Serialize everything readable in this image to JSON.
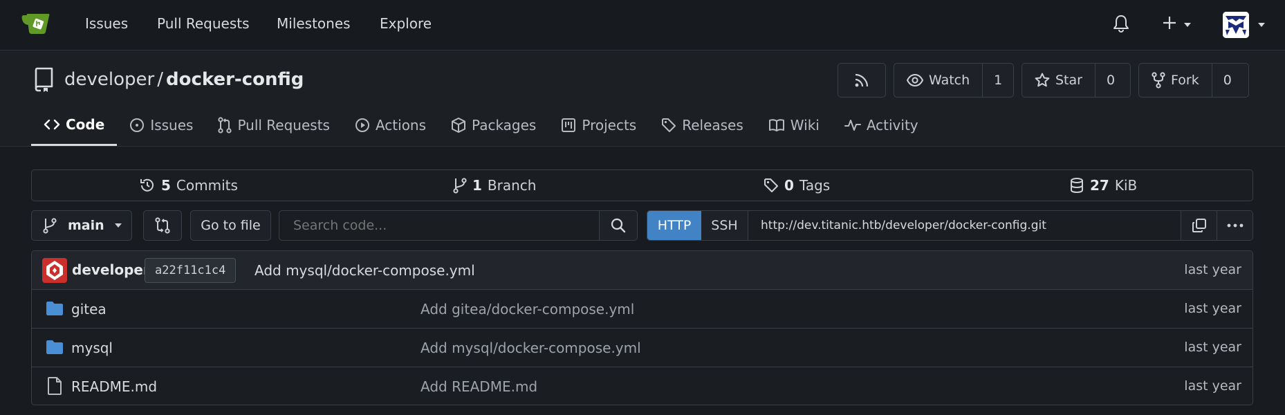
{
  "nav": {
    "links": [
      "Issues",
      "Pull Requests",
      "Milestones",
      "Explore"
    ]
  },
  "repo": {
    "owner": "developer",
    "separator": "/",
    "name": "docker-config",
    "watch_label": "Watch",
    "watch_count": "1",
    "star_label": "Star",
    "star_count": "0",
    "fork_label": "Fork",
    "fork_count": "0"
  },
  "tabs": [
    {
      "label": "Code",
      "icon": "code-icon"
    },
    {
      "label": "Issues",
      "icon": "issue-icon"
    },
    {
      "label": "Pull Requests",
      "icon": "pull-request-icon"
    },
    {
      "label": "Actions",
      "icon": "play-icon"
    },
    {
      "label": "Packages",
      "icon": "package-icon"
    },
    {
      "label": "Projects",
      "icon": "project-icon"
    },
    {
      "label": "Releases",
      "icon": "tag-icon"
    },
    {
      "label": "Wiki",
      "icon": "book-icon"
    },
    {
      "label": "Activity",
      "icon": "pulse-icon"
    }
  ],
  "stats": {
    "commits_count": "5",
    "commits_label": "Commits",
    "branch_count": "1",
    "branch_label": "Branch",
    "tags_count": "0",
    "tags_label": "Tags",
    "size_count": "27",
    "size_label": "KiB"
  },
  "toolbar": {
    "branch": "main",
    "go_to_file": "Go to file",
    "search_placeholder": "Search code...",
    "http_label": "HTTP",
    "ssh_label": "SSH",
    "clone_url": "http://dev.titanic.htb/developer/docker-config.git"
  },
  "last_commit": {
    "author": "developer",
    "sha": "a22f11c1c4",
    "message": "Add mysql/docker-compose.yml",
    "time": "last year"
  },
  "files": [
    {
      "name": "gitea",
      "type": "folder",
      "message": "Add gitea/docker-compose.yml",
      "time": "last year"
    },
    {
      "name": "mysql",
      "type": "folder",
      "message": "Add mysql/docker-compose.yml",
      "time": "last year"
    },
    {
      "name": "README.md",
      "type": "file",
      "message": "Add README.md",
      "time": "last year"
    }
  ],
  "colors": {
    "accent": "#4183c4",
    "folder": "#4a8fd6",
    "background": "#181c21"
  }
}
